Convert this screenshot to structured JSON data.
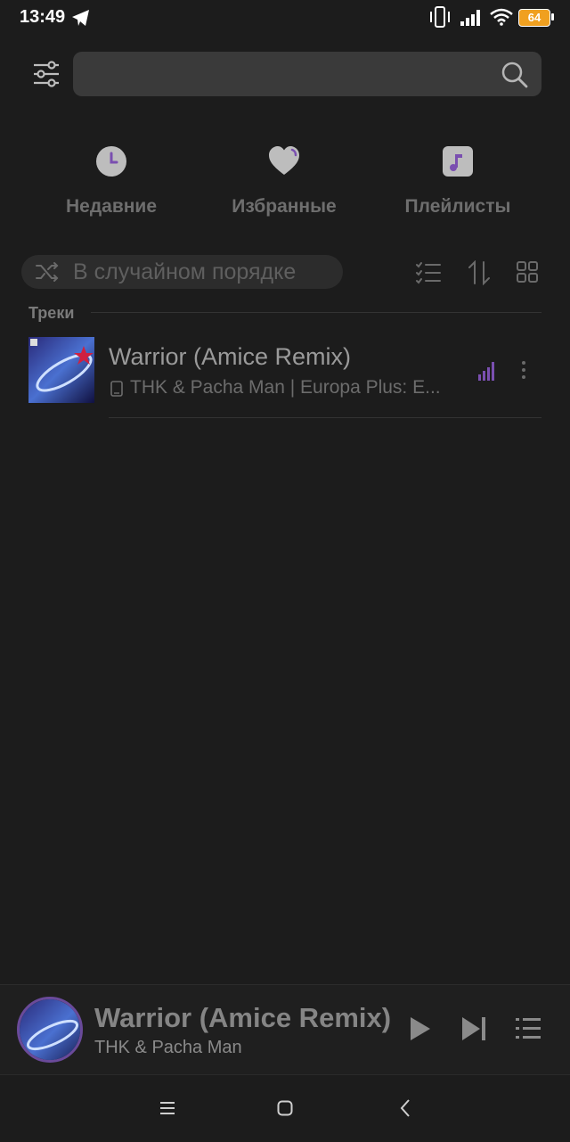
{
  "status_bar": {
    "time": "13:49",
    "battery_level": "64",
    "icons": [
      "telegram-icon",
      "vibrate-icon",
      "signal-icon",
      "wifi-icon",
      "battery-icon"
    ]
  },
  "search": {
    "placeholder": "",
    "filter_icon": "sliders-icon",
    "search_icon": "search-icon"
  },
  "quick_access": [
    {
      "label": "Недавние",
      "icon": "clock-icon"
    },
    {
      "label": "Избранные",
      "icon": "heart-icon"
    },
    {
      "label": "Плейлисты",
      "icon": "music-note-icon"
    }
  ],
  "shuffle": {
    "label": "В случайном порядке",
    "icon": "shuffle-icon"
  },
  "toolbar_icons": [
    "checklist-icon",
    "sort-icon",
    "grid-icon"
  ],
  "section": {
    "label": "Треки"
  },
  "tracks": [
    {
      "title": "Warrior (Amice Remix)",
      "subtitle": "THK & Pacha Man | Europa Plus: E...",
      "playing": true
    }
  ],
  "mini_player": {
    "title": "Warrior (Amice Remix)",
    "artist": "THK & Pacha Man"
  },
  "colors": {
    "background": "#1c1c1c",
    "accent": "#7a4fb0",
    "icon_muted": "#b5b5b5"
  }
}
